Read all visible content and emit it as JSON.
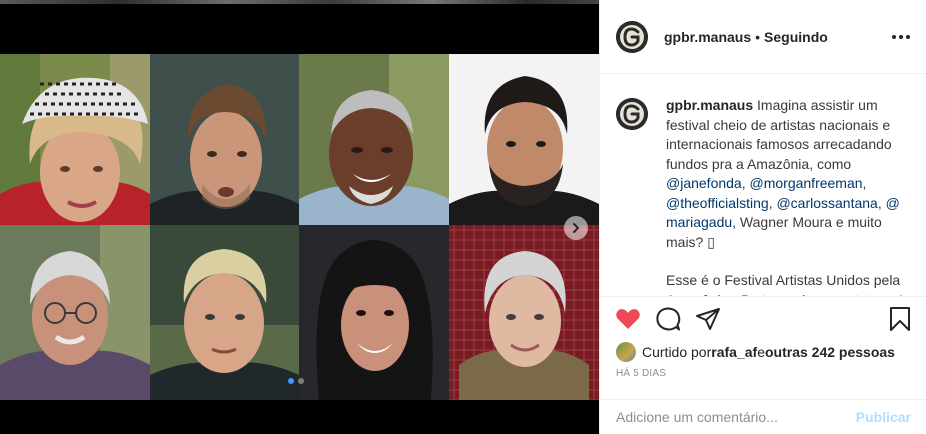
{
  "post": {
    "username": "gpbr.manaus",
    "separator": "•",
    "follow_status": "Seguindo",
    "more_icon": "more-horizontal-icon"
  },
  "caption": {
    "username": "gpbr.manaus",
    "text_1": " Imagina assistir um festival cheio de artistas nacionais e internacionais famosos arrecadando fundos pra a Amazônia, como ",
    "mentions": [
      "@janefonda",
      "@morganfreeman",
      "@theofficialsting",
      "@carlossantana",
      "@ mariagadu"
    ],
    "sep_1": ", ",
    "text_2": ", Wagner Moura e muito mais? ▯",
    "paragraph_2": "Esse é o Festival Artistas Unidos pela Amazônia - Protegendo os protetores!"
  },
  "actions": {
    "like_icon": "heart-icon",
    "comment_icon": "comment-icon",
    "share_icon": "send-icon",
    "save_icon": "bookmark-icon"
  },
  "likes": {
    "prefix": "Curtido por ",
    "user": "rafa_af",
    "middle": " e ",
    "others": "outras 242 pessoas"
  },
  "timestamp": "HÁ 5 DIAS",
  "comment_box": {
    "placeholder": "Adicione um comentário...",
    "publish_label": "Publicar"
  },
  "carousel": {
    "slide_count": 2,
    "active_slide": 1
  },
  "colors": {
    "like": "#ed4956",
    "mention": "#00376b",
    "publish_disabled": "#b2dffc",
    "active_dot": "#3d9aff"
  }
}
